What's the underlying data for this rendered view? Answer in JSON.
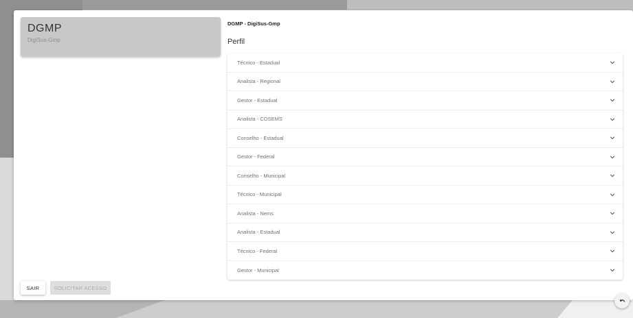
{
  "app": {
    "title": "DGMP",
    "subtitle": "DigiSus-Gmp"
  },
  "breadcrumb": "DGMP - DigiSus-Gmp",
  "section_title": "Perfil",
  "profiles": [
    {
      "label": "Técnico - Estadual",
      "icon": "chevron-down-icon"
    },
    {
      "label": "Analista - Regional",
      "icon": "chevron-down-icon"
    },
    {
      "label": "Gestor - Estadual",
      "icon": "chevron-down-icon"
    },
    {
      "label": "Analista - COSEMS",
      "icon": "chevron-down-icon"
    },
    {
      "label": "Conselho - Estadual",
      "icon": "chevron-down-icon"
    },
    {
      "label": "Gestor - Federal",
      "icon": "chevron-down-icon"
    },
    {
      "label": "Conselho - Municipal",
      "icon": "chevron-down-icon"
    },
    {
      "label": "Técnico - Municipal",
      "icon": "chevron-down-icon"
    },
    {
      "label": "Analista - Nems",
      "icon": "chevron-down-icon"
    },
    {
      "label": "Analista - Estadual",
      "icon": "chevron-down-icon"
    },
    {
      "label": "Técnico - Federal",
      "icon": "chevron-down-icon"
    },
    {
      "label": "Gestor - Municipal",
      "icon": "chevron-down-icon"
    }
  ],
  "buttons": {
    "sair": "SAIR",
    "solicitar": "SOLICITAR ACESSO"
  },
  "fab_icon": "undo-icon",
  "colors": {
    "card_bg": "#ffffff",
    "header_block": "#c8c8c8",
    "disabled_button": "#dedede"
  }
}
